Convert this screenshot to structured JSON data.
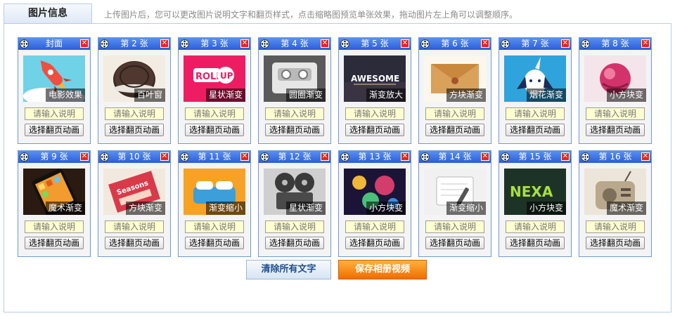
{
  "header": {
    "tab_title": "图片信息",
    "hint": "上传图片后，您可以更改图片说明文字和翻页样式，点击缩略图预览单张效果，拖动图片左上角可以调整顺序。"
  },
  "cards": [
    {
      "title": "封面",
      "effect": "电影效果",
      "theme": "rocket"
    },
    {
      "title": "第 2 张",
      "effect": "百叶窗",
      "theme": "oreo"
    },
    {
      "title": "第 3 张",
      "effect": "星状渐变",
      "theme": "rollup"
    },
    {
      "title": "第 4 张",
      "effect": "圆圈渐变",
      "theme": "cassette"
    },
    {
      "title": "第 5 张",
      "effect": "渐变放大",
      "theme": "awesome"
    },
    {
      "title": "第 6 张",
      "effect": "方块渐变",
      "theme": "envelope"
    },
    {
      "title": "第 7 张",
      "effect": "烟花渐变",
      "theme": "unicorn"
    },
    {
      "title": "第 8 张",
      "effect": "小方块变",
      "theme": "pinkball"
    },
    {
      "title": "第 9 张",
      "effect": "魔术渐变",
      "theme": "phone"
    },
    {
      "title": "第 10 张",
      "effect": "方块渐变",
      "theme": "seasons"
    },
    {
      "title": "第 11 张",
      "effect": "渐变缩小",
      "theme": "bed"
    },
    {
      "title": "第 12 张",
      "effect": "星状渐变",
      "theme": "projector"
    },
    {
      "title": "第 13 张",
      "effect": "小方块变",
      "theme": "collage"
    },
    {
      "title": "第 14 张",
      "effect": "渐变缩小",
      "theme": "notepad"
    },
    {
      "title": "第 15 张",
      "effect": "小方块变",
      "theme": "nexa"
    },
    {
      "title": "第 16 张",
      "effect": "魔术渐变",
      "theme": "radio"
    }
  ],
  "card_labels": {
    "caption_placeholder": "请输入说明",
    "animation_button": "选择翻页动画"
  },
  "actions": {
    "clear_text": "清除所有文字",
    "save_video": "保存相册视频"
  },
  "colors": {
    "card_header": "#2a5ed8",
    "close_button": "#e8231b",
    "save_button": "#f06c00"
  }
}
